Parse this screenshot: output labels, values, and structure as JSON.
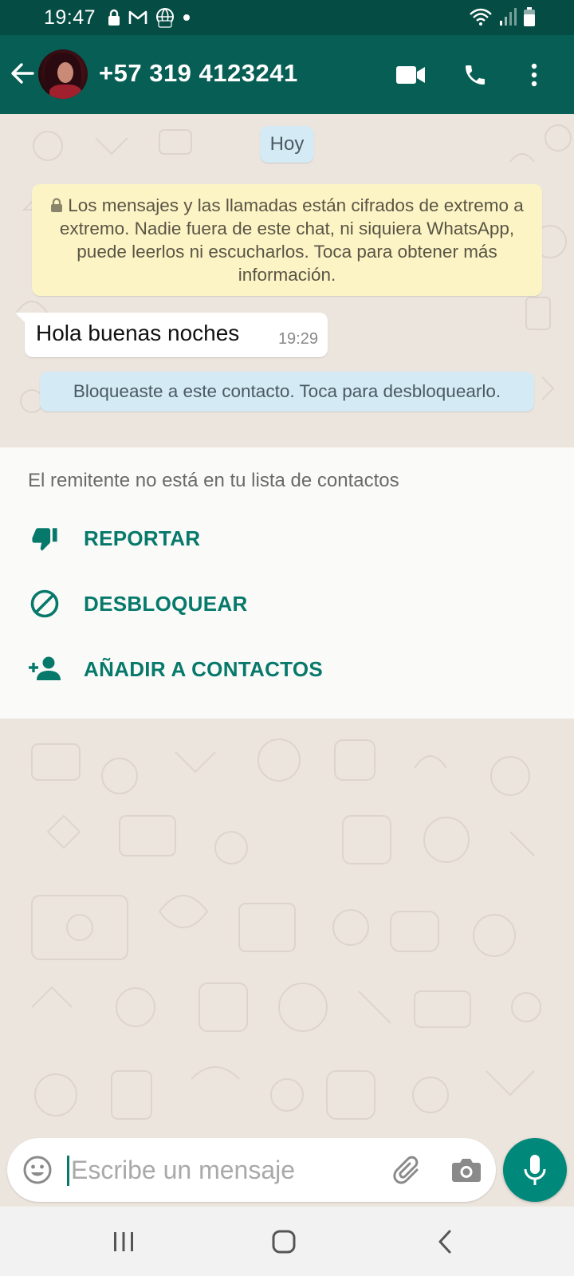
{
  "status_bar": {
    "time": "19:47",
    "icons_left": [
      "lock-icon",
      "gmail-icon",
      "globe-live-icon",
      "dot-icon"
    ],
    "icons_right": [
      "wifi-icon",
      "signal-icon",
      "battery-icon"
    ]
  },
  "app_bar": {
    "contact_name": "+57 319 4123241",
    "actions": [
      "video-call-icon",
      "voice-call-icon",
      "more-options-icon"
    ]
  },
  "chat": {
    "date_chip": "Hoy",
    "encryption_notice": "Los mensajes y las llamadas están cifrados de extremo a extremo. Nadie fuera de este chat, ni siquiera WhatsApp, puede leerlos ni escucharlos. Toca para obtener más información.",
    "messages": [
      {
        "text": "Hola buenas noches",
        "time": "19:29",
        "direction": "incoming"
      }
    ],
    "blocked_notice": "Bloqueaste a este contacto. Toca para desbloquearlo."
  },
  "sender_panel": {
    "notice": "El remitente no está en tu lista de contactos",
    "actions": [
      {
        "label": "REPORTAR",
        "icon": "thumbs-down-icon"
      },
      {
        "label": "DESBLOQUEAR",
        "icon": "block-icon"
      },
      {
        "label": "AÑADIR A CONTACTOS",
        "icon": "add-person-icon"
      }
    ]
  },
  "composer": {
    "placeholder": "Escribe un mensaje",
    "value": ""
  },
  "colors": {
    "header": "#075e54",
    "status_bar": "#054d44",
    "accent": "#00897b",
    "action_text": "#07796b",
    "chat_bg": "#ece5dd",
    "encryption_bg": "#fdf4c5",
    "system_chip_bg": "#d4eaf4"
  }
}
